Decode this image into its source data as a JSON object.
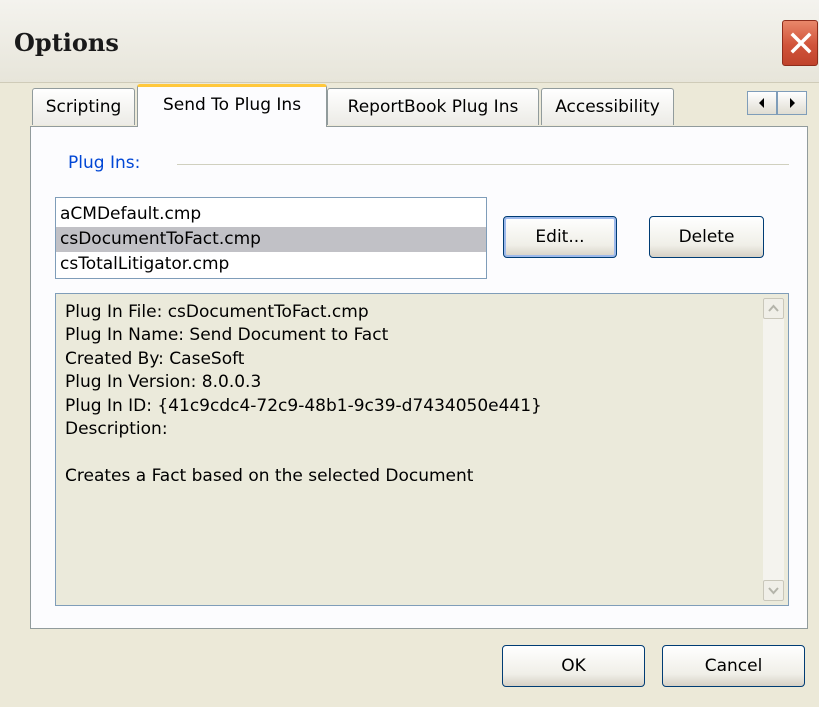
{
  "window": {
    "title": "Options"
  },
  "tabs": [
    {
      "label": "Scripting"
    },
    {
      "label": "Send To Plug Ins",
      "active": true
    },
    {
      "label": "ReportBook Plug Ins"
    },
    {
      "label": "Accessibility"
    }
  ],
  "tab_scroll": {
    "left_icon": "arrow-left-icon",
    "right_icon": "arrow-right-icon"
  },
  "plugins": {
    "group_label": "Plug Ins:",
    "items": [
      {
        "label": "aCMDefault.cmp"
      },
      {
        "label": "csDocumentToFact.cmp",
        "selected": true
      },
      {
        "label": "csTotalLitigator.cmp"
      }
    ],
    "edit_label": "Edit...",
    "delete_label": "Delete"
  },
  "details": {
    "lines": [
      "Plug In File: csDocumentToFact.cmp",
      "Plug In Name: Send Document to Fact",
      "Created By: CaseSoft",
      "Plug In Version: 8.0.0.3",
      "Plug In ID: {41c9cdc4-72c9-48b1-9c39-d7434050e441}",
      "Description:",
      "",
      "Creates a Fact based on the selected Document"
    ]
  },
  "footer": {
    "ok_label": "OK",
    "cancel_label": "Cancel"
  },
  "colors": {
    "accent_tab": "#ffc83c",
    "group_label": "#0046d5",
    "close": "#d0533a"
  }
}
